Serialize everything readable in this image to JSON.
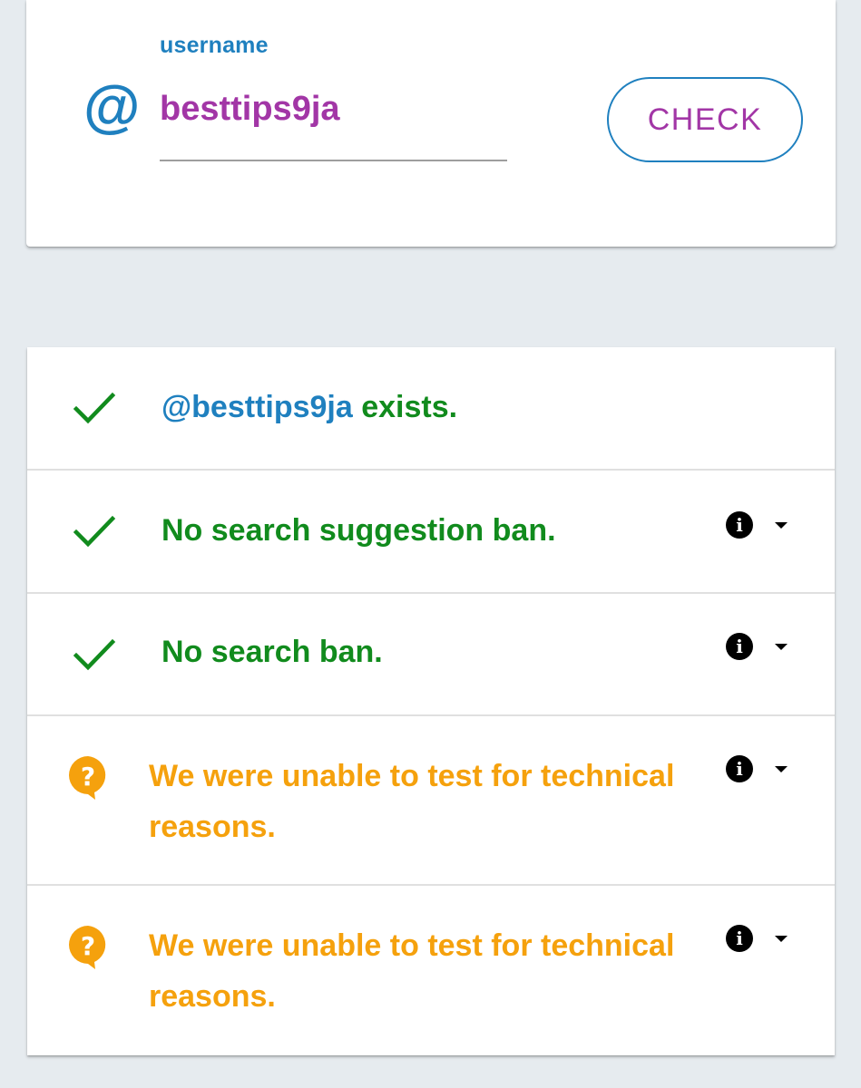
{
  "search": {
    "label": "username",
    "value": "besttips9ja",
    "at_symbol": "@",
    "button_label": "CHECK",
    "at_icon": "at-sign-icon"
  },
  "results": [
    {
      "status": "ok",
      "icon": "check-icon",
      "handle": "@besttips9ja",
      "text": "exists.",
      "has_info": false
    },
    {
      "status": "ok",
      "icon": "check-icon",
      "text": "No search suggestion ban.",
      "has_info": true
    },
    {
      "status": "ok",
      "icon": "check-icon",
      "text": "No search ban.",
      "has_info": true
    },
    {
      "status": "unknown",
      "icon": "question-bubble-icon",
      "text": "We were unable to test for technical reasons.",
      "has_info": true
    },
    {
      "status": "unknown",
      "icon": "question-bubble-icon",
      "text": "We were unable to test for technical reasons.",
      "has_info": true
    }
  ],
  "colors": {
    "accent_blue": "#1f80bf",
    "value_purple": "#a236a6",
    "ok_green": "#118b1d",
    "warn_orange": "#f5a10d",
    "background": "#e6ebef"
  },
  "info_glyph": "i"
}
